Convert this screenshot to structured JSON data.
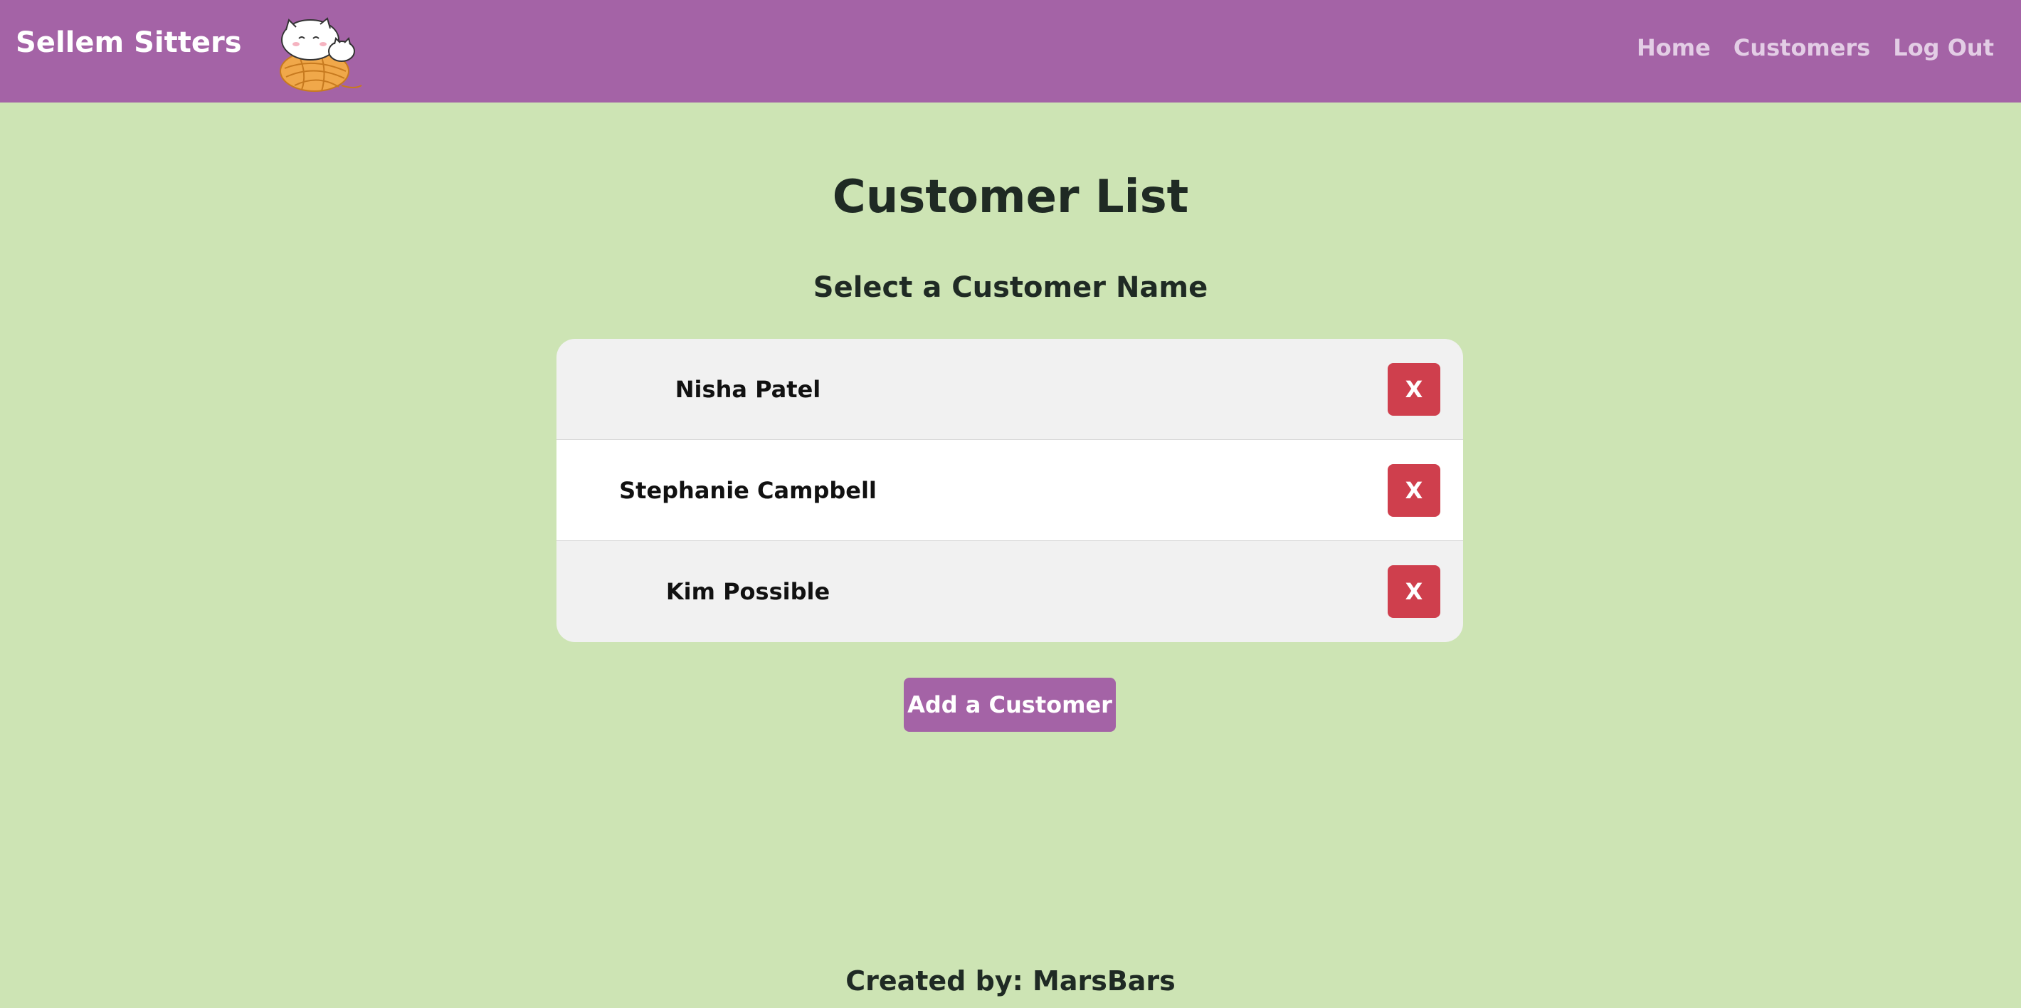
{
  "header": {
    "brand": "Sellem Sitters",
    "logo_icon": "cat-on-yarn-ball-icon",
    "nav": [
      {
        "label": "Home"
      },
      {
        "label": "Customers"
      },
      {
        "label": "Log Out"
      }
    ]
  },
  "main": {
    "title": "Customer List",
    "subtitle": "Select a Customer Name",
    "customers": [
      {
        "name": "Nisha Patel",
        "delete_label": "X"
      },
      {
        "name": "Stephanie Campbell",
        "delete_label": "X"
      },
      {
        "name": "Kim Possible",
        "delete_label": "X"
      }
    ],
    "add_button": "Add a Customer"
  },
  "footer": {
    "text": "Created by: MarsBars"
  },
  "colors": {
    "nav_bg": "#a463a6",
    "page_bg": "#cde4b4",
    "delete_button": "#cf3f4d",
    "row_alt": "#f1f1f1"
  }
}
